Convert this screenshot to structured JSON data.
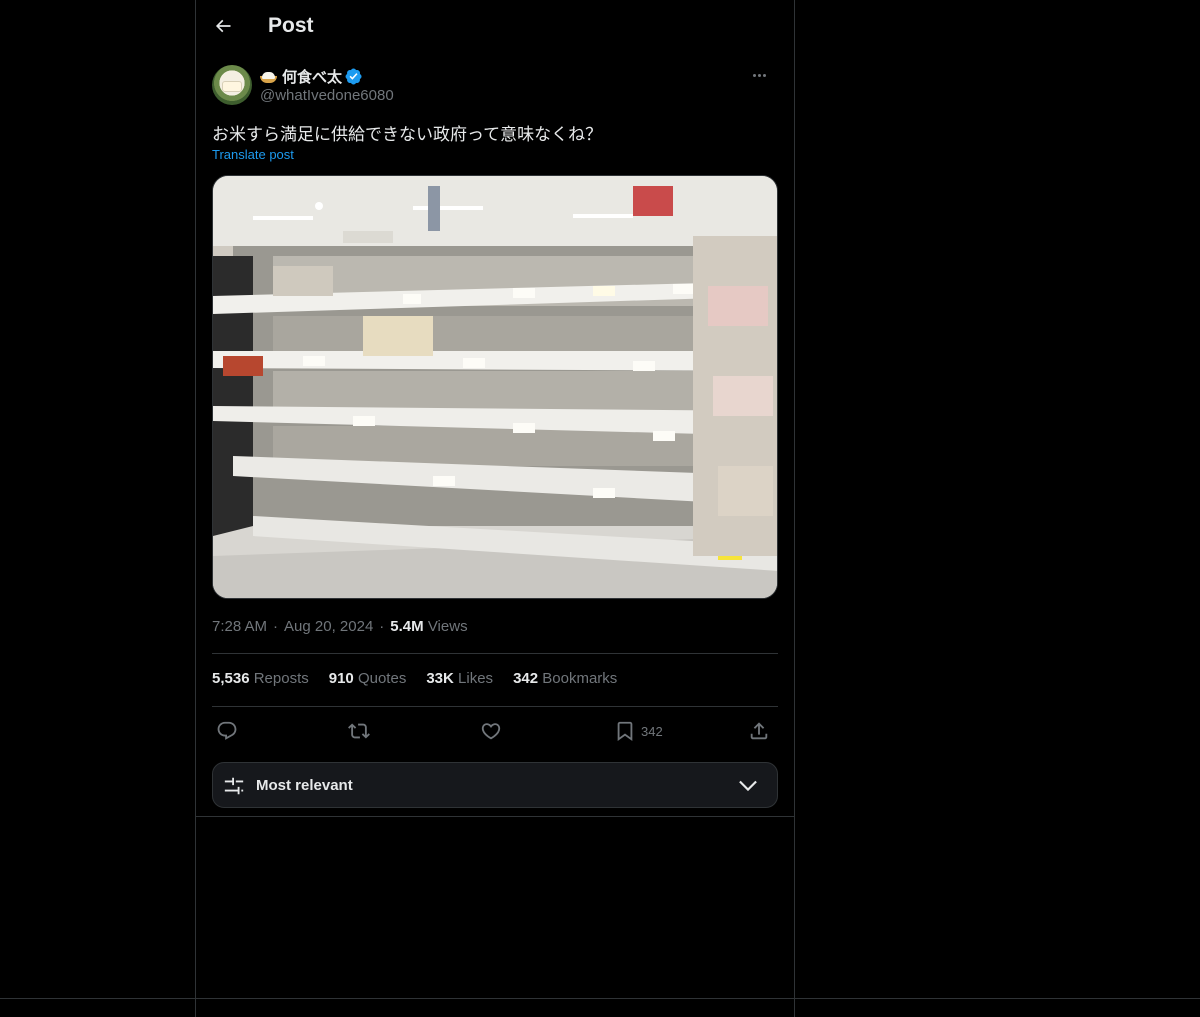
{
  "header": {
    "title": "Post"
  },
  "post": {
    "author": {
      "display_name": "何食べ太",
      "handle": "@whatIvedone6080",
      "verified": true
    },
    "text": "お米すら満足に供給できない政府って意味なくね？",
    "translate_label": "Translate post",
    "media": {
      "alt": "Photo of mostly empty supermarket rice shelves"
    },
    "timestamp": {
      "time": "7:28 AM",
      "separator": "·",
      "date": "Aug 20, 2024",
      "views": "5.4M",
      "views_label": "Views"
    },
    "stats": {
      "reposts": "5,536",
      "reposts_label": "Reposts",
      "quotes": "910",
      "quotes_label": "Quotes",
      "likes": "33K",
      "likes_label": "Likes",
      "bookmarks": "342",
      "bookmarks_label": "Bookmarks"
    },
    "actions": {
      "reply_icon": "reply-icon",
      "repost_icon": "repost-icon",
      "like_icon": "heart-icon",
      "bookmark_icon": "bookmark-icon",
      "bookmark_count": "342",
      "share_icon": "share-icon"
    }
  },
  "replies_sort": {
    "label": "Most relevant"
  },
  "colors": {
    "background": "#000000",
    "accent": "#1d9bf0",
    "text": "#e7e9ea",
    "muted": "#71767b",
    "border": "#2f3336"
  }
}
